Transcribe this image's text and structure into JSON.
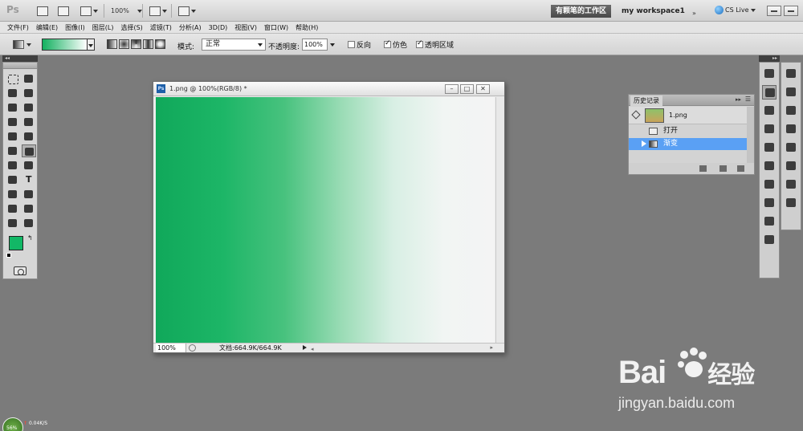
{
  "appbar": {
    "logo": "Ps",
    "zoom": "100%",
    "workspace_active": "有颗笔的工作区",
    "workspace_other": "my workspace1",
    "cs_live": "CS Live"
  },
  "menu": [
    "文件(F)",
    "编辑(E)",
    "图像(I)",
    "图层(L)",
    "选择(S)",
    "滤镜(T)",
    "分析(A)",
    "3D(D)",
    "视图(V)",
    "窗口(W)",
    "帮助(H)"
  ],
  "options": {
    "mode_label": "模式:",
    "mode_value": "正常",
    "opacity_label": "不透明度:",
    "opacity_value": "100%",
    "reverse_label": "反向",
    "dither_label": "仿色",
    "transparency_label": "透明区域",
    "gradient_colors": [
      "#12b05f",
      "#ffffff"
    ]
  },
  "colors": {
    "foreground": "#12b866",
    "background": "#ffffff"
  },
  "document": {
    "title": "1.png @ 100%(RGB/8) *",
    "zoom": "100%",
    "doc_info": "文档:664.9K/664.9K"
  },
  "history": {
    "tab": "历史记录",
    "snapshot_label": "1.png",
    "items": [
      {
        "label": "打开",
        "active": false
      },
      {
        "label": "渐变",
        "active": true
      }
    ]
  },
  "bottom": {
    "gauge": "56%",
    "rate": "0.04K/S"
  },
  "watermark": {
    "brand": "Bai",
    "brand_suffix": "经验",
    "url": "jingyan.baidu.com"
  }
}
